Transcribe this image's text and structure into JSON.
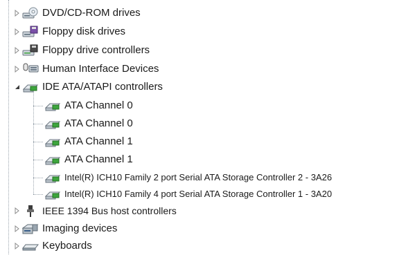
{
  "tree": {
    "categories": [
      {
        "label": "DVD/CD-ROM drives",
        "icon": "dvd-drive-icon",
        "expanded": false
      },
      {
        "label": "Floppy disk drives",
        "icon": "floppy-disk-icon",
        "expanded": false
      },
      {
        "label": "Floppy drive controllers",
        "icon": "floppy-controller-icon",
        "expanded": false
      },
      {
        "label": "Human Interface Devices",
        "icon": "hid-icon",
        "expanded": false
      },
      {
        "label": "IDE ATA/ATAPI controllers",
        "icon": "ide-controller-icon",
        "expanded": true,
        "children": [
          {
            "label": "ATA Channel 0",
            "icon": "ide-controller-icon"
          },
          {
            "label": "ATA Channel 0",
            "icon": "ide-controller-icon"
          },
          {
            "label": "ATA Channel 1",
            "icon": "ide-controller-icon"
          },
          {
            "label": "ATA Channel 1",
            "icon": "ide-controller-icon"
          },
          {
            "label": "Intel(R) ICH10 Family 2 port Serial ATA Storage Controller 2 - 3A26",
            "icon": "ide-controller-icon"
          },
          {
            "label": "Intel(R) ICH10 Family 4 port Serial ATA Storage Controller 1 - 3A20",
            "icon": "ide-controller-icon"
          }
        ]
      },
      {
        "label": "IEEE 1394 Bus host controllers",
        "icon": "ieee1394-icon",
        "expanded": false
      },
      {
        "label": "Imaging devices",
        "icon": "imaging-device-icon",
        "expanded": false
      },
      {
        "label": "Keyboards",
        "icon": "keyboard-icon",
        "expanded": false
      }
    ]
  }
}
